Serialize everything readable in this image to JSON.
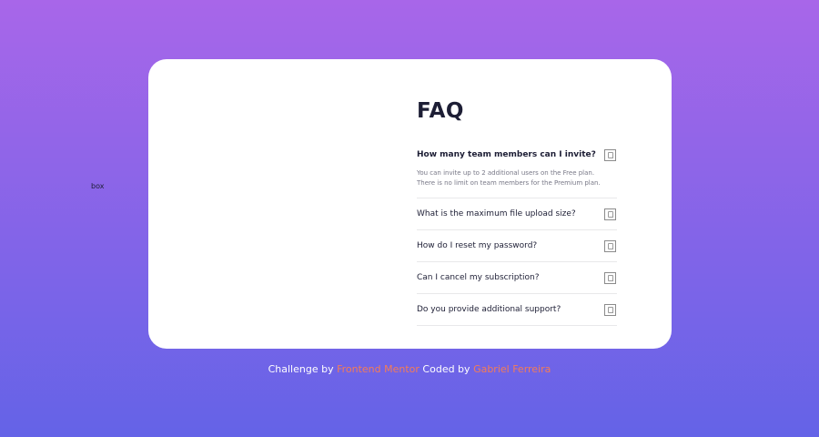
{
  "stray_label": "box",
  "faq": {
    "title": "FAQ",
    "items": [
      {
        "question": "How many team members can I invite?",
        "open": true,
        "answer_line1": "You can invite up to 2 additional users on the Free plan.",
        "answer_line2": "There is no limit on team members for the Premium plan.",
        "icon": "document-icon"
      },
      {
        "question": "What is the maximum file upload size?",
        "open": false,
        "icon": "document-icon"
      },
      {
        "question": "How do I reset my password?",
        "open": false,
        "icon": "document-icon"
      },
      {
        "question": "Can I cancel my subscription?",
        "open": false,
        "icon": "document-icon"
      },
      {
        "question": "Do you provide additional support?",
        "open": false,
        "icon": "document-icon"
      }
    ]
  },
  "footer": {
    "prefix": "Challenge by",
    "challenge_link": "Frontend Mentor",
    "middle": "Coded by",
    "author_link": "Gabriel Ferreira"
  },
  "colors": {
    "background_top": "#a866e9",
    "background_bottom": "#6463e7",
    "card": "#ffffff",
    "heading": "#1d1e35",
    "link": "#f47c57"
  }
}
